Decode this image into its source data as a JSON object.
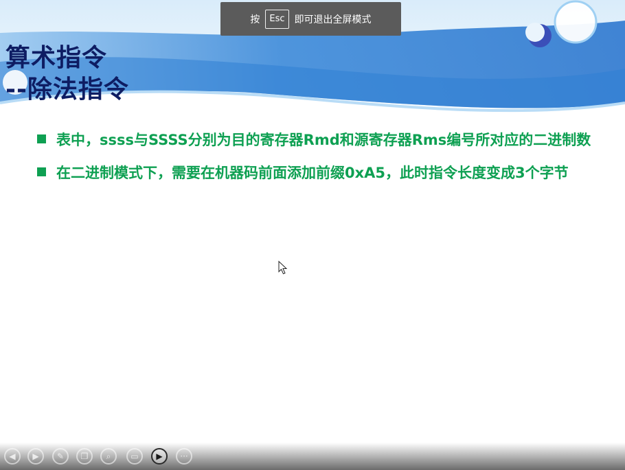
{
  "slide": {
    "title_lines": [
      "算术指令",
      "--除法指令"
    ],
    "bullets": [
      "表中，ssss与SSSS分别为目的寄存器Rmd和源寄存器Rms编号所对应的二进制数",
      "在二进制模式下，需要在机器码前面添加前缀0xA5，此时指令长度变成3个字节"
    ]
  },
  "fullscreen_notice": {
    "prefix": "按",
    "key": "Esc",
    "suffix": "即可退出全屏模式"
  },
  "toolbar": {
    "buttons": [
      {
        "name": "previous-icon",
        "glyph": "◀"
      },
      {
        "name": "next-icon",
        "glyph": "▶"
      },
      {
        "name": "pen-icon",
        "glyph": "✎"
      },
      {
        "name": "copy-icon",
        "glyph": "❐"
      },
      {
        "name": "zoom-icon",
        "glyph": "⌕"
      },
      {
        "name": "screen-icon",
        "glyph": "▭"
      },
      {
        "name": "video-camera-icon",
        "glyph": "▶"
      },
      {
        "name": "more-icon",
        "glyph": "···"
      }
    ]
  },
  "colors": {
    "title": "#0e1d63",
    "bullet_text": "#0ea052",
    "header_blue": "#3a86d8",
    "toast_bg": "#5b5b5b"
  }
}
